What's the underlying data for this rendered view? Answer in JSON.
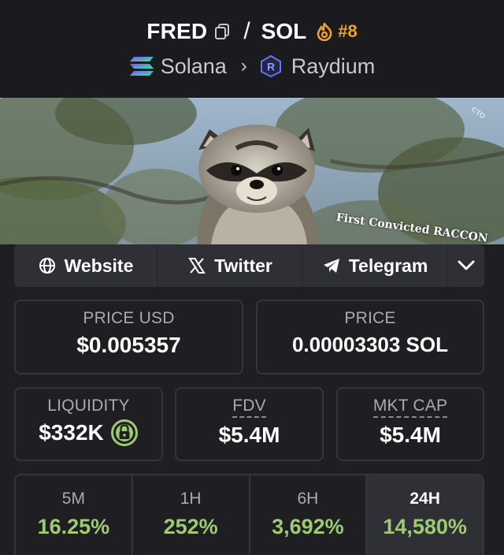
{
  "header": {
    "base_symbol": "FRED",
    "separator": "/",
    "quote_symbol": "SOL",
    "rank": "#8",
    "chain": "Solana",
    "dex": "Raydium"
  },
  "banner": {
    "badge": "CTO",
    "tagline": "First Convicted RACCON"
  },
  "links": [
    {
      "label": "Website",
      "icon": "globe-icon"
    },
    {
      "label": "Twitter",
      "icon": "x-logo-icon"
    },
    {
      "label": "Telegram",
      "icon": "telegram-icon"
    }
  ],
  "stats": {
    "price_usd_label": "PRICE USD",
    "price_usd": "$0.005357",
    "price_label": "PRICE",
    "price_native": "0.00003303 SOL",
    "liquidity_label": "LIQUIDITY",
    "liquidity": "$332K",
    "fdv_label": "FDV",
    "fdv": "$5.4M",
    "mktcap_label": "MKT CAP",
    "mktcap": "$5.4M"
  },
  "periods": [
    {
      "label": "5M",
      "value": "16.25%"
    },
    {
      "label": "1H",
      "value": "252%"
    },
    {
      "label": "6H",
      "value": "3,692%"
    },
    {
      "label": "24H",
      "value": "14,580%"
    }
  ],
  "colors": {
    "accent_rank": "#f0a12a",
    "positive": "#9ccc6f",
    "liquidity_lock": "#9ccc6f"
  }
}
